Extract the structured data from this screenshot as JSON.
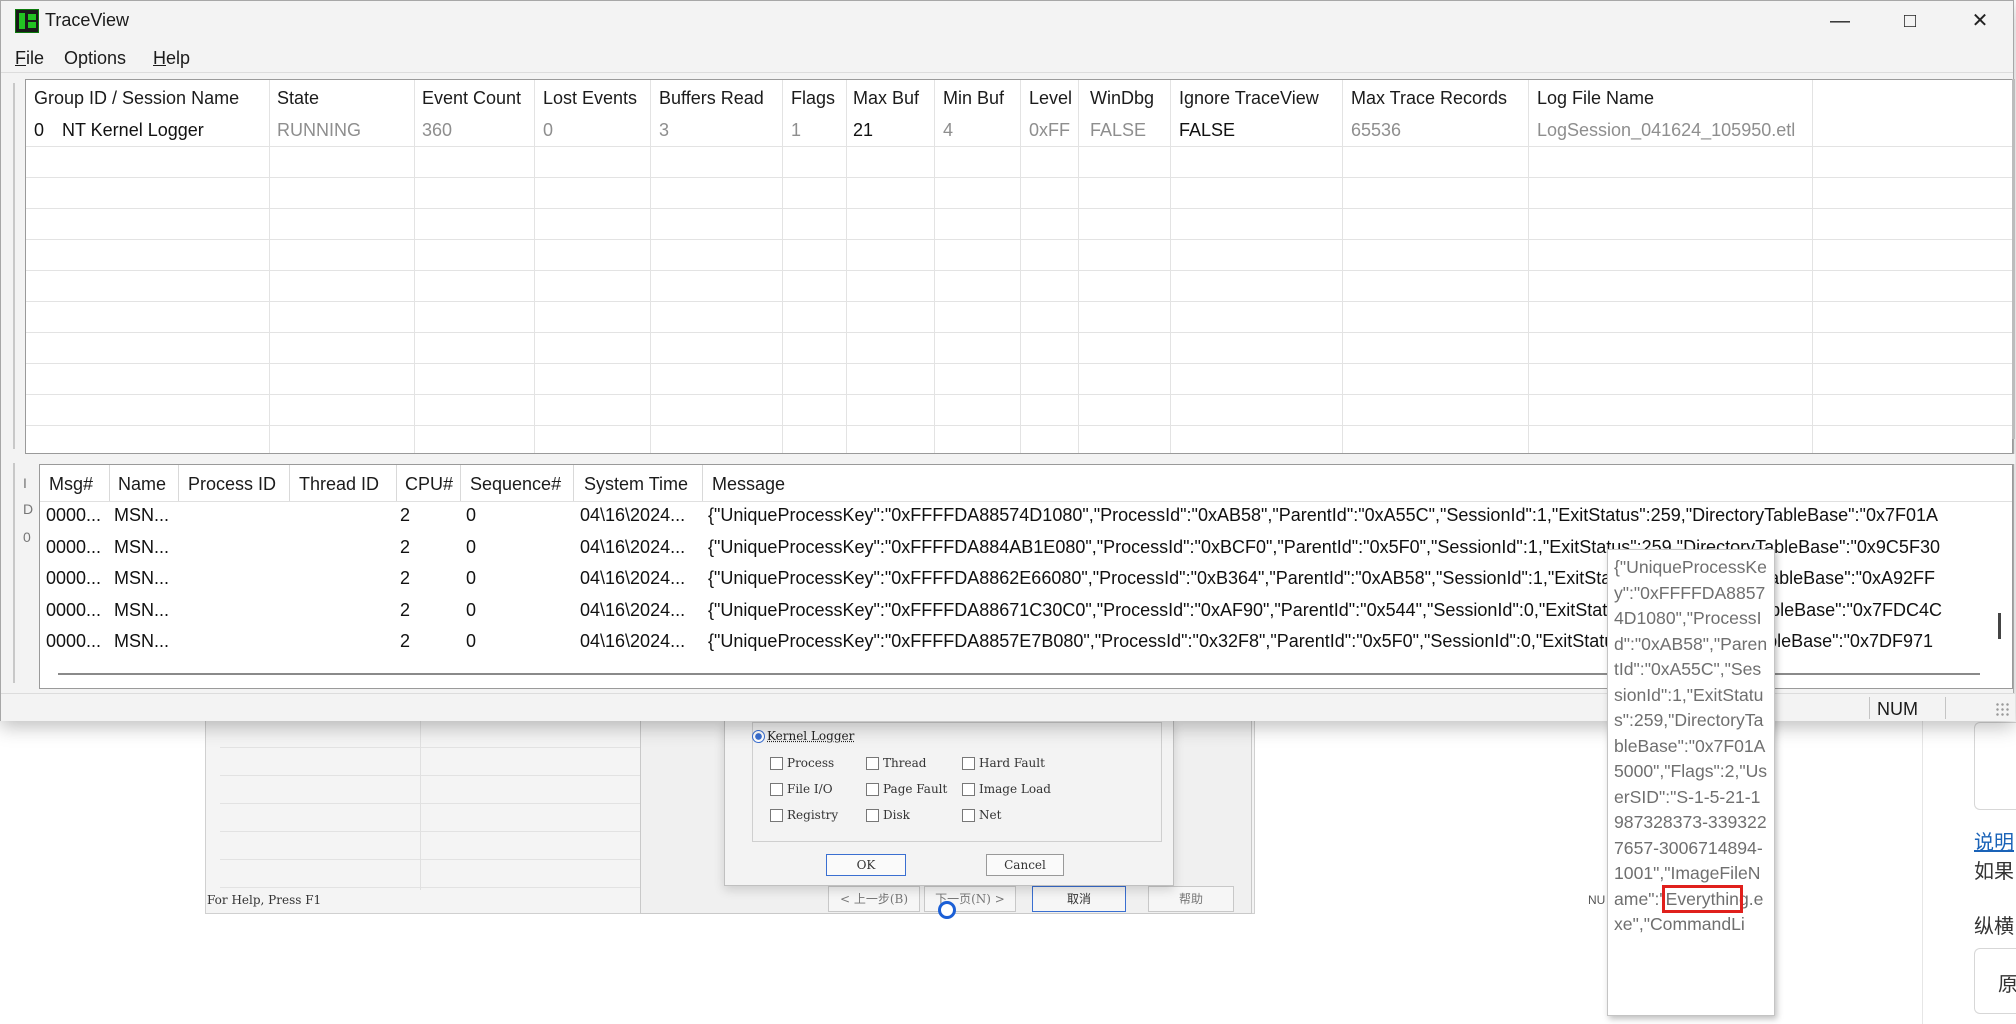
{
  "window": {
    "title": "TraceView",
    "minimize_glyph": "—",
    "maximize_glyph": "□",
    "close_glyph": "✕"
  },
  "menu": {
    "file": {
      "accel": "F",
      "rest": "ile"
    },
    "options": "Options",
    "help": {
      "accel": "H",
      "rest": "elp"
    }
  },
  "sessions": {
    "headers": [
      "Group ID / Session Name",
      "State",
      "Event Count",
      "Lost Events",
      "Buffers Read",
      "Flags",
      "Max Buf",
      "Min Buf",
      "Level",
      "WinDbg",
      "Ignore TraceView",
      "Max Trace Records",
      "Log File Name"
    ],
    "row": {
      "group_id": "0",
      "session_name": "NT Kernel Logger",
      "state": "RUNNING",
      "event_count": "360",
      "lost_events": "0",
      "buffers_read": "3",
      "flags": "1",
      "max_buf": "21",
      "min_buf": "4",
      "level": "0xFF",
      "windbg": "FALSE",
      "ignore_traceview": "FALSE",
      "max_trace_records": "65536",
      "log_file_name": "LogSession_041624_105950.etl"
    }
  },
  "events": {
    "gutter_labels": [
      "I",
      "D",
      "0"
    ],
    "headers": [
      "Msg#",
      "Name",
      "Process ID",
      "Thread ID",
      "CPU#",
      "Sequence#",
      "System Time",
      "Message"
    ],
    "rows": [
      {
        "msg": "0000...",
        "name": "MSN...",
        "pid": "",
        "tid": "",
        "cpu": "2",
        "seq": "0",
        "time": "04\\16\\2024...",
        "message": "{\"UniqueProcessKey\":\"0xFFFFDA88574D1080\",\"ProcessId\":\"0xAB58\",\"ParentId\":\"0xA55C\",\"SessionId\":1,\"ExitStatus\":259,\"DirectoryTableBase\":\"0x7F01A"
      },
      {
        "msg": "0000...",
        "name": "MSN...",
        "pid": "",
        "tid": "",
        "cpu": "2",
        "seq": "0",
        "time": "04\\16\\2024...",
        "message": "{\"UniqueProcessKey\":\"0xFFFFDA884AB1E080\",\"ProcessId\":\"0xBCF0\",\"ParentId\":\"0x5F0\",\"SessionId\":1,\"ExitStatus\":259,\"DirectoryTableBase\":\"0x9C5F30"
      },
      {
        "msg": "0000...",
        "name": "MSN...",
        "pid": "",
        "tid": "",
        "cpu": "2",
        "seq": "0",
        "time": "04\\16\\2024...",
        "message": "{\"UniqueProcessKey\":\"0xFFFFDA8862E66080\",\"ProcessId\":\"0xB364\",\"ParentId\":\"0xAB58\",\"SessionId\":1,\"ExitStatus\":259,\"DirectoryTableBase\":\"0xA92FF"
      },
      {
        "msg": "0000...",
        "name": "MSN...",
        "pid": "",
        "tid": "",
        "cpu": "2",
        "seq": "0",
        "time": "04\\16\\2024...",
        "message": "{\"UniqueProcessKey\":\"0xFFFFDA88671C30C0\",\"ProcessId\":\"0xAF90\",\"ParentId\":\"0x544\",\"SessionId\":0,\"ExitStatus\":259,\"DirectoryTableBase\":\"0x7FDC4C"
      },
      {
        "msg": "0000...",
        "name": "MSN...",
        "pid": "",
        "tid": "",
        "cpu": "2",
        "seq": "0",
        "time": "04\\16\\2024...",
        "message": "{\"UniqueProcessKey\":\"0xFFFFDA8857E7B080\",\"ProcessId\":\"0x32F8\",\"ParentId\":\"0x5F0\",\"SessionId\":0,\"ExitStatus\":259,\"DirectoryTableBase\":\"0x7DF971"
      }
    ]
  },
  "statusbar": {
    "num": "NUM"
  },
  "tooltip": {
    "before": "{\"UniqueProcessKey\":\"0xFFFFDA88574D1080\",\"ProcessId\":\"0xAB58\",\"ParentId\":\"0xA55C\",\"SessionId\":1,\"ExitStatus\":259,\"DirectoryTableBase\":\"0x7F01A5000\",\"Flags\":2,\"UserSID\":\"S-1-5-21-1987328373-3393227657-3006714894-1001\",\"ImageFileName\":\"",
    "highlight": "Everythin",
    "after": "g.exe\",\"CommandLi"
  },
  "background": {
    "inner_status_left": "For Help, Press F1",
    "inner_status_right": "NU",
    "dialog": {
      "radio_label": "Kernel Logger",
      "checkboxes": [
        "Process",
        "Thread",
        "Hard Fault",
        "File I/O",
        "Page Fault",
        "Image Load",
        "Registry",
        "Disk",
        "Net"
      ],
      "ok": "OK",
      "cancel": "Cancel"
    },
    "wizard_buttons": [
      "< 上一步(B)",
      "下一页(N) >",
      "取消",
      "帮助"
    ],
    "right_link": "说明",
    "right_text1": "如果",
    "right_text2": "纵横",
    "right_text3": "原"
  }
}
